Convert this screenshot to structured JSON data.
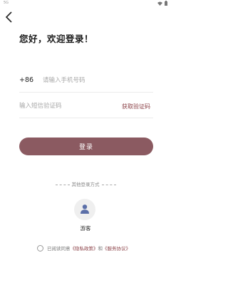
{
  "status_bar": {
    "left_text": "5G",
    "icons": [
      "wifi-icon",
      "battery-icon"
    ]
  },
  "header": {
    "back_icon": "chevron-left-icon",
    "title": "您好，欢迎登录！"
  },
  "phone": {
    "country_code": "+86",
    "placeholder": "请输入手机号码",
    "value": ""
  },
  "code": {
    "placeholder": "输入短信验证码",
    "value": "",
    "get_code_label": "获取验证码"
  },
  "login_button": {
    "label": "登录"
  },
  "other_login": {
    "label": "其他登录方式"
  },
  "guest": {
    "icon": "user-icon",
    "label": "游客"
  },
  "agreement": {
    "prefix": "已阅读同意",
    "privacy_link": "《隐私政策》",
    "and": "和",
    "service_link": "《服务协议》"
  },
  "colors": {
    "primary": "#8b5a61",
    "link": "#8a3f45",
    "avatar_bg": "#efefef",
    "user_icon": "#5b6fa8"
  }
}
